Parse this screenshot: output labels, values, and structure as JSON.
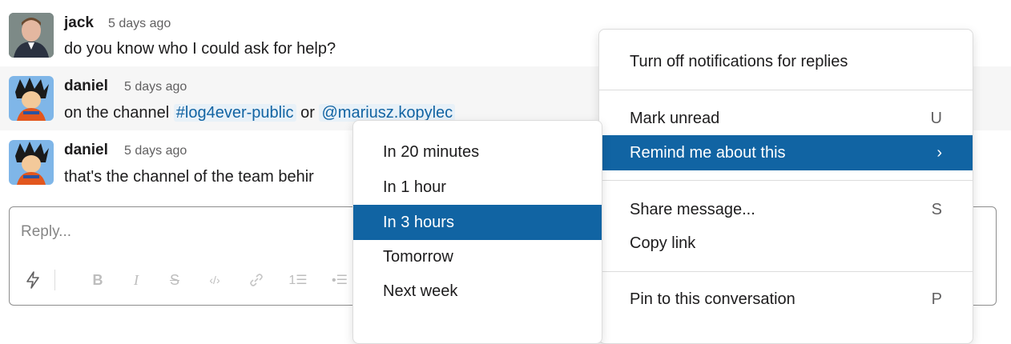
{
  "thread": {
    "messages": [
      {
        "author": "jack",
        "time": "5 days ago",
        "text": "do you know who I could ask for help?"
      },
      {
        "author": "daniel",
        "time": "5 days ago",
        "text_prefix": "on the channel",
        "channel": "#log4ever-public",
        "joiner": "or",
        "mention": "@mariusz.kopylec"
      },
      {
        "author": "daniel",
        "time": "5 days ago",
        "text": "that's the channel of the team behir"
      }
    ]
  },
  "composer": {
    "placeholder": "Reply...",
    "toolbar": [
      "bolt-icon",
      "bold-icon",
      "italic-icon",
      "strikethrough-icon",
      "code-icon",
      "link-icon",
      "ordered-list-icon",
      "bulleted-list-icon"
    ]
  },
  "context_menu": {
    "items": [
      {
        "label": "Turn off notifications for replies"
      },
      {
        "label": "Mark unread",
        "shortcut": "U"
      },
      {
        "label": "Remind me about this",
        "shortcut": "›"
      },
      {
        "label": "Share message...",
        "shortcut": "S"
      },
      {
        "label": "Copy link"
      },
      {
        "label": "Pin to this conversation",
        "shortcut": "P"
      }
    ]
  },
  "remind_submenu": {
    "items": [
      {
        "label": "In 20 minutes"
      },
      {
        "label": "In 1 hour"
      },
      {
        "label": "In 3 hours"
      },
      {
        "label": "Tomorrow"
      },
      {
        "label": "Next week"
      }
    ]
  },
  "colors": {
    "accent": "#1164a3",
    "link": "#1264a3",
    "mention_bg": "#e8f1f8"
  }
}
